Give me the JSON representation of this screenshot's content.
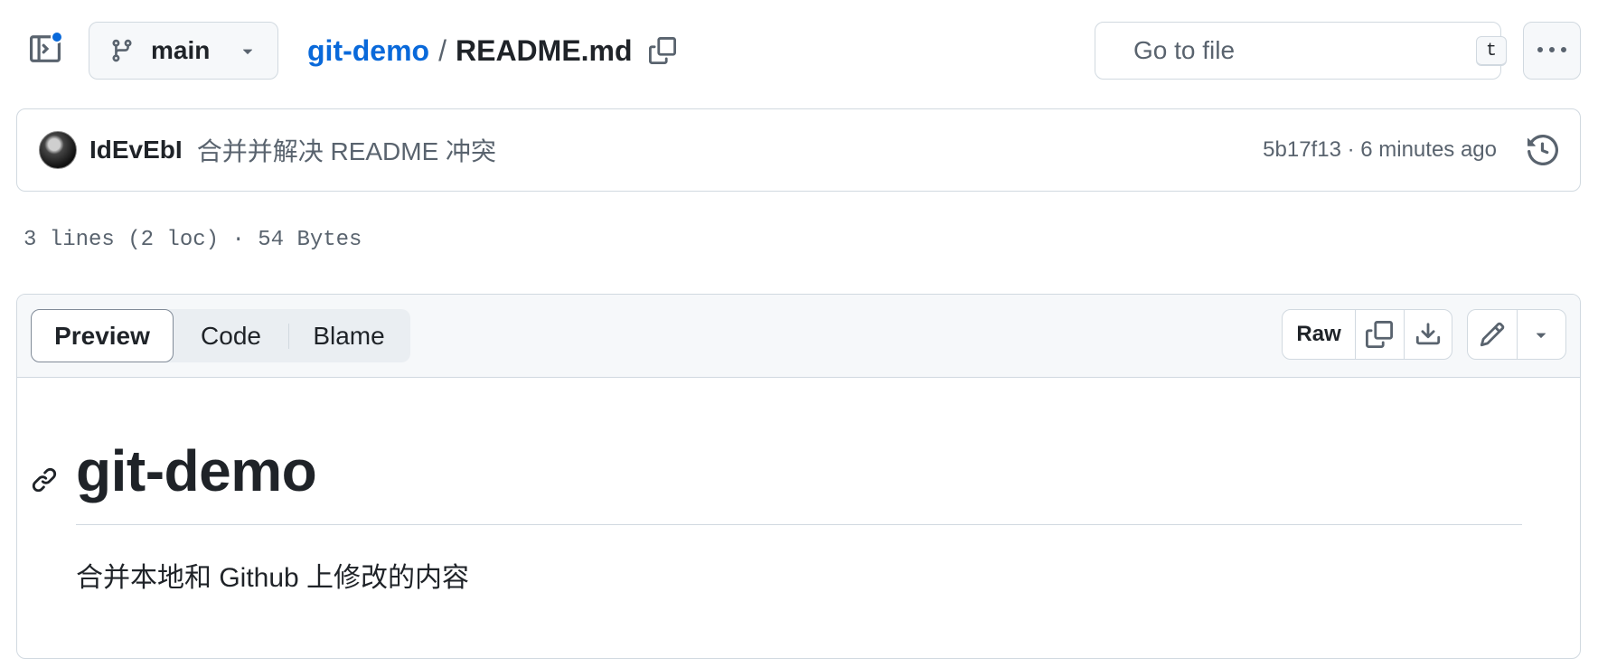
{
  "topbar": {
    "branch": "main",
    "repo": "git-demo",
    "separator": "/",
    "file": "README.md",
    "search_placeholder": "Go to file",
    "search_shortcut": "t"
  },
  "commit": {
    "author": "IdEvEbI",
    "message": "合并并解决 README 冲突",
    "meta": "5b17f13 · 6 minutes ago"
  },
  "file_stats": "3 lines (2 loc) · 54 Bytes",
  "viewer": {
    "tabs": [
      "Preview",
      "Code",
      "Blame"
    ],
    "active_tab": "Preview",
    "raw_label": "Raw"
  },
  "readme": {
    "heading": "git-demo",
    "paragraph": "合并本地和 Github 上修改的内容"
  },
  "colors": {
    "accent": "#0969da",
    "border": "#d1d9e0",
    "muted_text": "#59636e",
    "header_bg": "#f6f8fa"
  },
  "icons": [
    "sidebar-toggle-icon",
    "git-branch-icon",
    "triangle-down-icon",
    "copy-icon",
    "search-icon",
    "kebab-horizontal-icon",
    "history-icon",
    "download-icon",
    "pencil-icon",
    "link-icon"
  ]
}
